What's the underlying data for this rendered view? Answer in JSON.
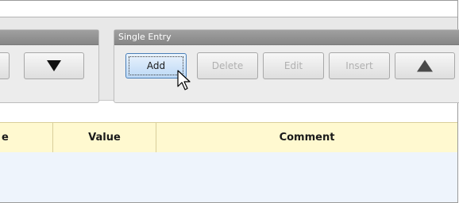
{
  "toolbar": {
    "single_entry_group": {
      "title": "Single Entry",
      "buttons": {
        "add": "Add",
        "delete": "Delete",
        "edit": "Edit",
        "insert": "Insert"
      }
    }
  },
  "table": {
    "columns": [
      "e",
      "Value",
      "Comment"
    ]
  },
  "icons": {
    "move_down": "down-triangle-icon",
    "move_up": "up-triangle-icon",
    "cursor": "mouse-pointer-icon"
  },
  "colors": {
    "active_button_border": "#4a7fb8",
    "header_background": "#fff9d0",
    "body_background": "#eef4fc",
    "group_header": "#8f8f8f"
  }
}
